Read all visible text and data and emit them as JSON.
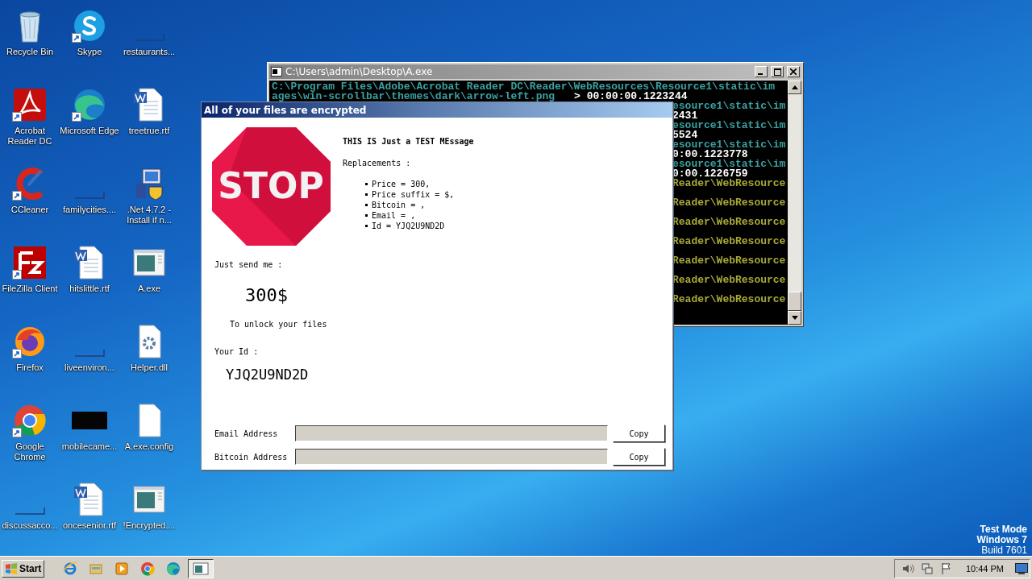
{
  "desktop_icons": [
    {
      "label": "Recycle Bin",
      "kind": "recycle",
      "shortcut": false
    },
    {
      "label": "Skype",
      "kind": "skype",
      "shortcut": true
    },
    {
      "label": "restaurants...",
      "kind": "blank",
      "shortcut": false
    },
    {
      "label": "Acrobat Reader DC",
      "kind": "acrobat",
      "shortcut": true
    },
    {
      "label": "Microsoft Edge",
      "kind": "edge",
      "shortcut": true
    },
    {
      "label": "treetrue.rtf",
      "kind": "word",
      "shortcut": false
    },
    {
      "label": "CCleaner",
      "kind": "ccleaner",
      "shortcut": true
    },
    {
      "label": "familycities....",
      "kind": "blank",
      "shortcut": false
    },
    {
      "label": ".Net 4.7.2 - Install if n...",
      "kind": "installer",
      "shortcut": false
    },
    {
      "label": "FileZilla Client",
      "kind": "filezilla",
      "shortcut": true
    },
    {
      "label": "hitslittle.rtf",
      "kind": "word",
      "shortcut": false
    },
    {
      "label": "A.exe",
      "kind": "app",
      "shortcut": false
    },
    {
      "label": "Firefox",
      "kind": "firefox",
      "shortcut": true
    },
    {
      "label": "liveenviron...",
      "kind": "blank",
      "shortcut": false
    },
    {
      "label": "Helper.dll",
      "kind": "dll",
      "shortcut": false
    },
    {
      "label": "Google Chrome",
      "kind": "chrome",
      "shortcut": true
    },
    {
      "label": "mobilecame...",
      "kind": "black",
      "shortcut": false
    },
    {
      "label": "A.exe.config",
      "kind": "file",
      "shortcut": false
    },
    {
      "label": "discussacco...",
      "kind": "blank",
      "shortcut": false
    },
    {
      "label": "oncesenior.rtf",
      "kind": "word",
      "shortcut": false
    },
    {
      "label": "!Encrypted....",
      "kind": "app",
      "shortcut": false
    }
  ],
  "console": {
    "title": "C:\\Users\\admin\\Desktop\\A.exe",
    "lines": [
      {
        "cut": false,
        "parts": [
          {
            "kind": "path",
            "text": "C:\\Program Files\\Adobe\\Acrobat Reader DC\\Reader\\WebResources\\Resource1\\static\\im"
          }
        ]
      },
      {
        "cut": false,
        "parts": [
          {
            "kind": "path",
            "text": "ages\\win-scrollbar\\themes\\dark\\arrow-left.png"
          },
          {
            "kind": "time",
            "text": "> 00:00:00.1223244"
          }
        ]
      },
      {
        "cut": true,
        "parts": [
          {
            "kind": "path",
            "text": "esource1\\static\\im"
          }
        ]
      },
      {
        "cut": true,
        "parts": [
          {
            "kind": "time",
            "text": "2431"
          }
        ]
      },
      {
        "cut": true,
        "parts": [
          {
            "kind": "path",
            "text": "esource1\\static\\im"
          }
        ]
      },
      {
        "cut": true,
        "parts": [
          {
            "kind": "time",
            "text": "5524"
          }
        ]
      },
      {
        "cut": true,
        "parts": [
          {
            "kind": "path",
            "text": "esource1\\static\\im"
          }
        ]
      },
      {
        "cut": true,
        "parts": [
          {
            "kind": "time",
            "text": "0:00.1223778"
          }
        ]
      },
      {
        "cut": true,
        "parts": [
          {
            "kind": "path",
            "text": "esource1\\static\\im"
          }
        ]
      },
      {
        "cut": true,
        "parts": [
          {
            "kind": "time",
            "text": "0:00.1226759"
          }
        ]
      },
      {
        "cut": true,
        "parts": [
          {
            "kind": "reader",
            "text": "Reader\\WebResource"
          }
        ]
      },
      {
        "cut": true,
        "parts": [
          {
            "kind": "reader",
            "text": "Reader\\WebResource"
          }
        ]
      },
      {
        "cut": true,
        "parts": [
          {
            "kind": "reader",
            "text": "Reader\\WebResource"
          }
        ]
      },
      {
        "cut": true,
        "parts": [
          {
            "kind": "reader",
            "text": "Reader\\WebResource"
          }
        ]
      },
      {
        "cut": true,
        "parts": [
          {
            "kind": "reader",
            "text": "Reader\\WebResource"
          }
        ]
      },
      {
        "cut": true,
        "parts": [
          {
            "kind": "reader",
            "text": "Reader\\WebResource"
          }
        ]
      },
      {
        "cut": true,
        "parts": [
          {
            "kind": "reader",
            "text": "Reader\\WebResource"
          }
        ]
      }
    ]
  },
  "dialog": {
    "title": "All of your files are encrypted",
    "stop_sign": "STOP",
    "heading": "THIS IS Just a TEST MEssage",
    "replacements_label": "Replacements :",
    "replacements": [
      "Price = 300,",
      "Price suffix = $,",
      "Bitcoin = ,",
      "Email = ,",
      "Id = YJQ2U9ND2D"
    ],
    "send_label": "Just send me :",
    "amount": "300$",
    "unlock_text": "To unlock your files",
    "id_label": "Your Id :",
    "id": "YJQ2U9ND2D",
    "fields": [
      {
        "label": "Email Address",
        "disabled": true,
        "button": "Copy"
      },
      {
        "label": "Bitcoin Address",
        "disabled": true,
        "button": "Copy"
      }
    ]
  },
  "os_notice": [
    "Test Mode",
    "Windows 7",
    "Build 7601"
  ],
  "taskbar": {
    "start": "Start",
    "quick_launch": [
      {
        "kind": "ie"
      },
      {
        "kind": "explorer"
      },
      {
        "kind": "media"
      },
      {
        "kind": "chrome"
      },
      {
        "kind": "edge"
      }
    ],
    "tasks": [
      {
        "kind": "console",
        "selected": true
      }
    ],
    "tray": [
      {
        "kind": "speaker"
      },
      {
        "kind": "network"
      },
      {
        "kind": "flag"
      }
    ],
    "clock": "10:44 PM"
  }
}
